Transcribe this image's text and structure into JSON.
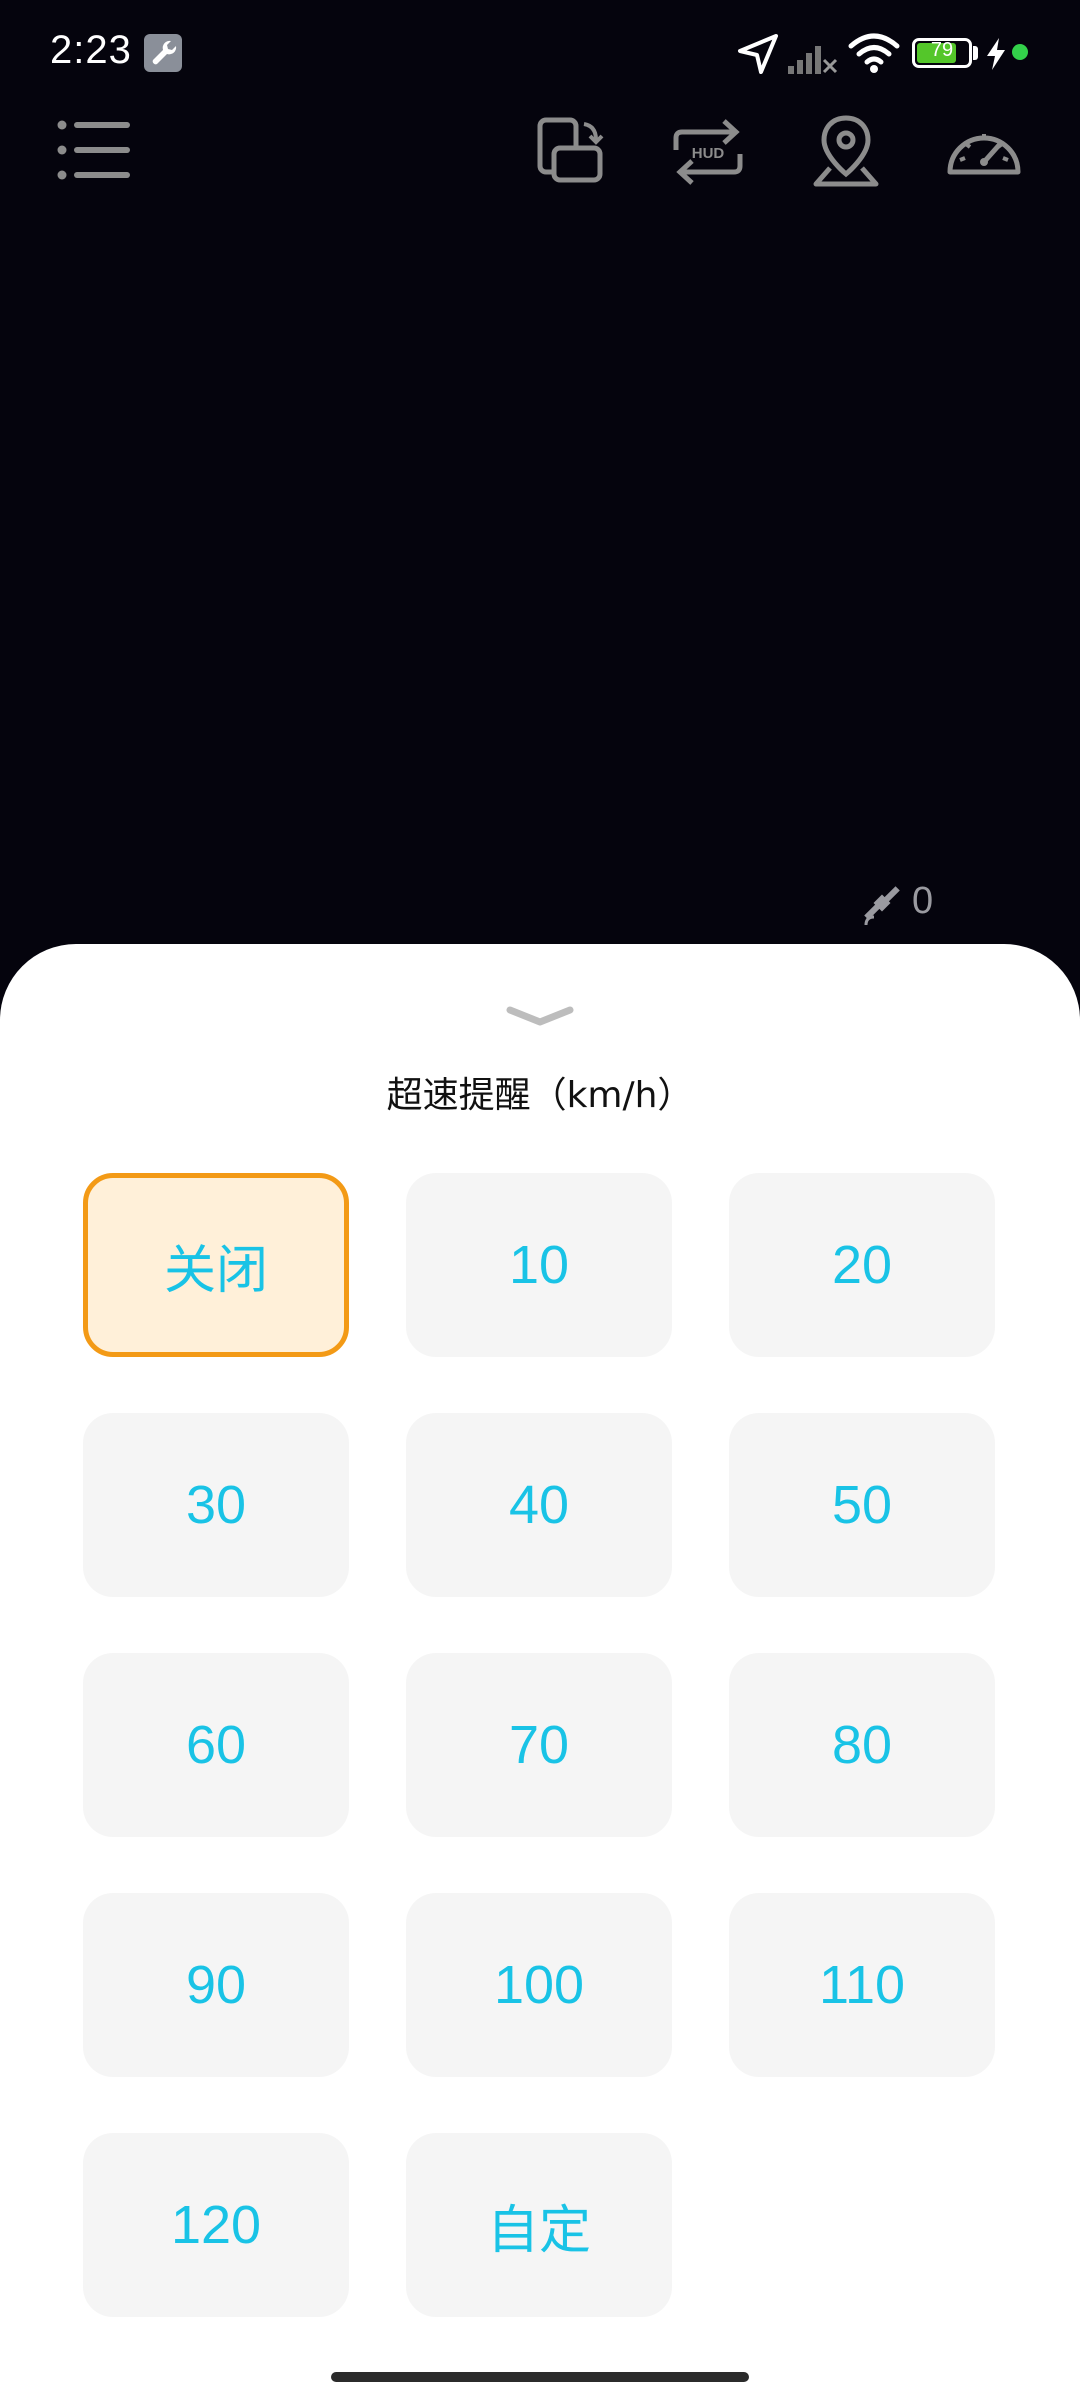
{
  "status_bar": {
    "time": "2:23",
    "battery_level": "79",
    "battery_fill_percent": 79
  },
  "toolbar": {
    "icons": [
      "menu-icon",
      "screen-rotate-icon",
      "hud-swap-icon",
      "location-pin-icon",
      "speedometer-icon"
    ]
  },
  "gps": {
    "satellite_count": "0"
  },
  "sheet": {
    "title": "超速提醒（km/h）",
    "selected_index": 0,
    "options": [
      "关闭",
      "10",
      "20",
      "30",
      "40",
      "50",
      "60",
      "70",
      "80",
      "90",
      "100",
      "110",
      "120",
      "自定"
    ]
  },
  "colors": {
    "background": "#05040d",
    "accent_text": "#19c3e6",
    "selected_border": "#f39a16",
    "selected_fill": "#fff0d9",
    "option_fill": "#f5f5f5",
    "battery_green": "#54c62a"
  }
}
